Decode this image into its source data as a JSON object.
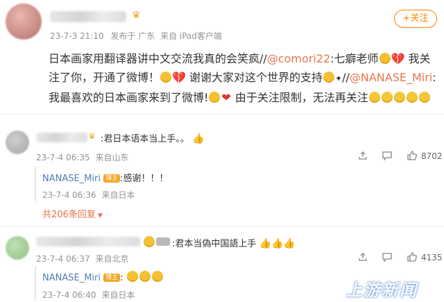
{
  "post": {
    "author_badge_icon": "crown-icon",
    "timestamp": "23-7-3 21:10",
    "location": "发布于 广东",
    "source": "来自 iPad客户端",
    "follow_button": "+关注",
    "text_a": "日本画家用翻译器讲中文交流我真的会笑疯//",
    "mention_1": "@comori22",
    "text_b": ":七癖老师",
    "text_c": " 我关注了你，开通了微博！",
    "text_d": " 谢谢大家对这个世界的支持",
    "text_e": "//",
    "mention_2": "@NANASE_Miri",
    "text_f": ":我最喜欢的日本画家来到了微博!",
    "text_g": " 由于关注限制，无法再关注"
  },
  "comments": [
    {
      "text": ":君日本语本当上手。。",
      "timestamp": "23-7-4 06:35",
      "location": "来自山东",
      "like_count": "8702",
      "reply": {
        "author": "NANASE_Miri",
        "badge": "博主",
        "text": ":感谢！！！",
        "timestamp": "23-7-4 06:36",
        "location": "来自日本"
      },
      "more_replies": "共206条回复"
    },
    {
      "text": ":君本当偽中国語上手",
      "timestamp": "23-7-4 06:37",
      "location": "来自北京",
      "like_count": "4135",
      "reply": {
        "author": "NANASE_Miri",
        "badge": "博主",
        "text": ":",
        "timestamp": "23-7-4 06:40",
        "location": "来自日本"
      }
    }
  ],
  "watermark": "上游新闻"
}
